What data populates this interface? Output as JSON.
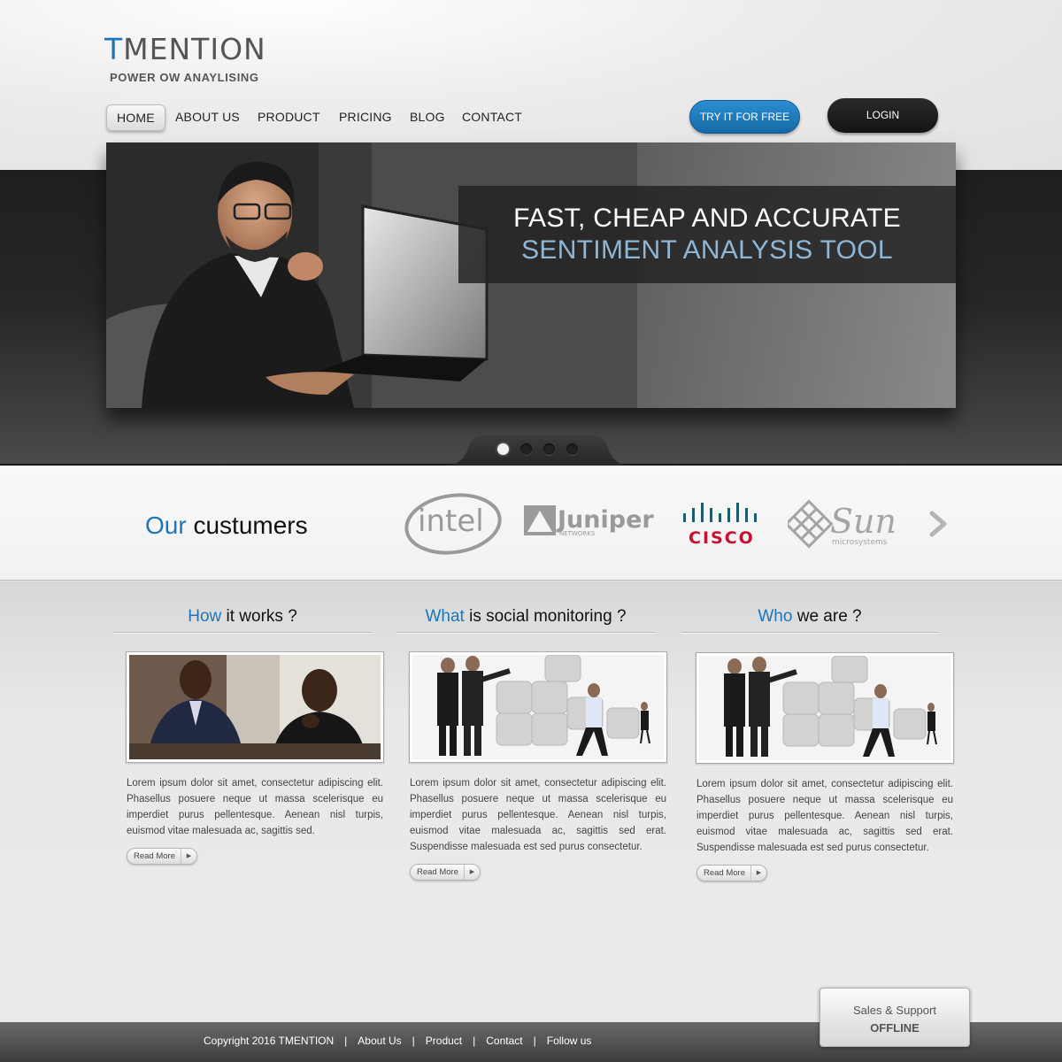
{
  "brand": {
    "name_first_letter": "T",
    "name_rest": "MENTION",
    "tagline": "POWER OW ANAYLISING",
    "accent_color": "#1e76b8"
  },
  "nav": {
    "items": [
      {
        "label": "HOME",
        "active": true
      },
      {
        "label": "ABOUT US"
      },
      {
        "label": "PRODUCT"
      },
      {
        "label": "PRICING"
      },
      {
        "label": "BLOG"
      },
      {
        "label": "CONTACT"
      }
    ],
    "try_label": "TRY IT FOR FREE",
    "login_label": "LOGIN"
  },
  "hero": {
    "line1": "FAST, CHEAP AND ACCURATE",
    "line2": "SENTIMENT ANALYSIS TOOL",
    "slide_count": 4,
    "active_slide": 1
  },
  "customers": {
    "title_blue": "Our",
    "title_rest": "custumers",
    "logos": [
      "intel",
      "Juniper",
      "CISCO",
      "Sun"
    ],
    "juniper_sub": "NETWORKS",
    "sun_sub": "microsystems"
  },
  "columns": [
    {
      "title_blue": "How",
      "title_rest": "it works",
      "title_q": "?",
      "text": "Lorem ipsum dolor sit amet, consectetur adipiscing elit. Phasellus posuere neque ut massa scelerisque eu imperdiet purus pellentesque. Aenean nisl turpis, euismod vitae malesuada ac, sagittis sed.",
      "read_more": "Read More"
    },
    {
      "title_blue": "What",
      "title_rest": "is social monitoring",
      "title_q": "?",
      "text": "Lorem ipsum dolor sit amet, consectetur adipiscing elit. Phasellus posuere neque ut massa scelerisque eu imperdiet purus pellentesque. Aenean nisl turpis, euismod vitae malesuada ac, sagittis sed erat. Suspendisse malesuada est sed purus consectetur.",
      "read_more": "Read More"
    },
    {
      "title_blue": "Who",
      "title_rest": "we are",
      "title_q": "?",
      "text": "Lorem ipsum dolor sit amet, consectetur adipiscing elit. Phasellus posuere neque ut massa scelerisque eu imperdiet purus pellentesque. Aenean nisl turpis, euismod vitae malesuada ac, sagittis sed erat. Suspendisse malesuada est sed purus consectetur.",
      "read_more": "Read More"
    }
  ],
  "footer": {
    "copyright": "Copyright 2016 TMENTION",
    "separator": "|",
    "links": [
      "About Us",
      "Product",
      "Contact",
      "Follow us"
    ]
  },
  "support": {
    "title": "Sales & Support",
    "status": "OFFLINE"
  }
}
